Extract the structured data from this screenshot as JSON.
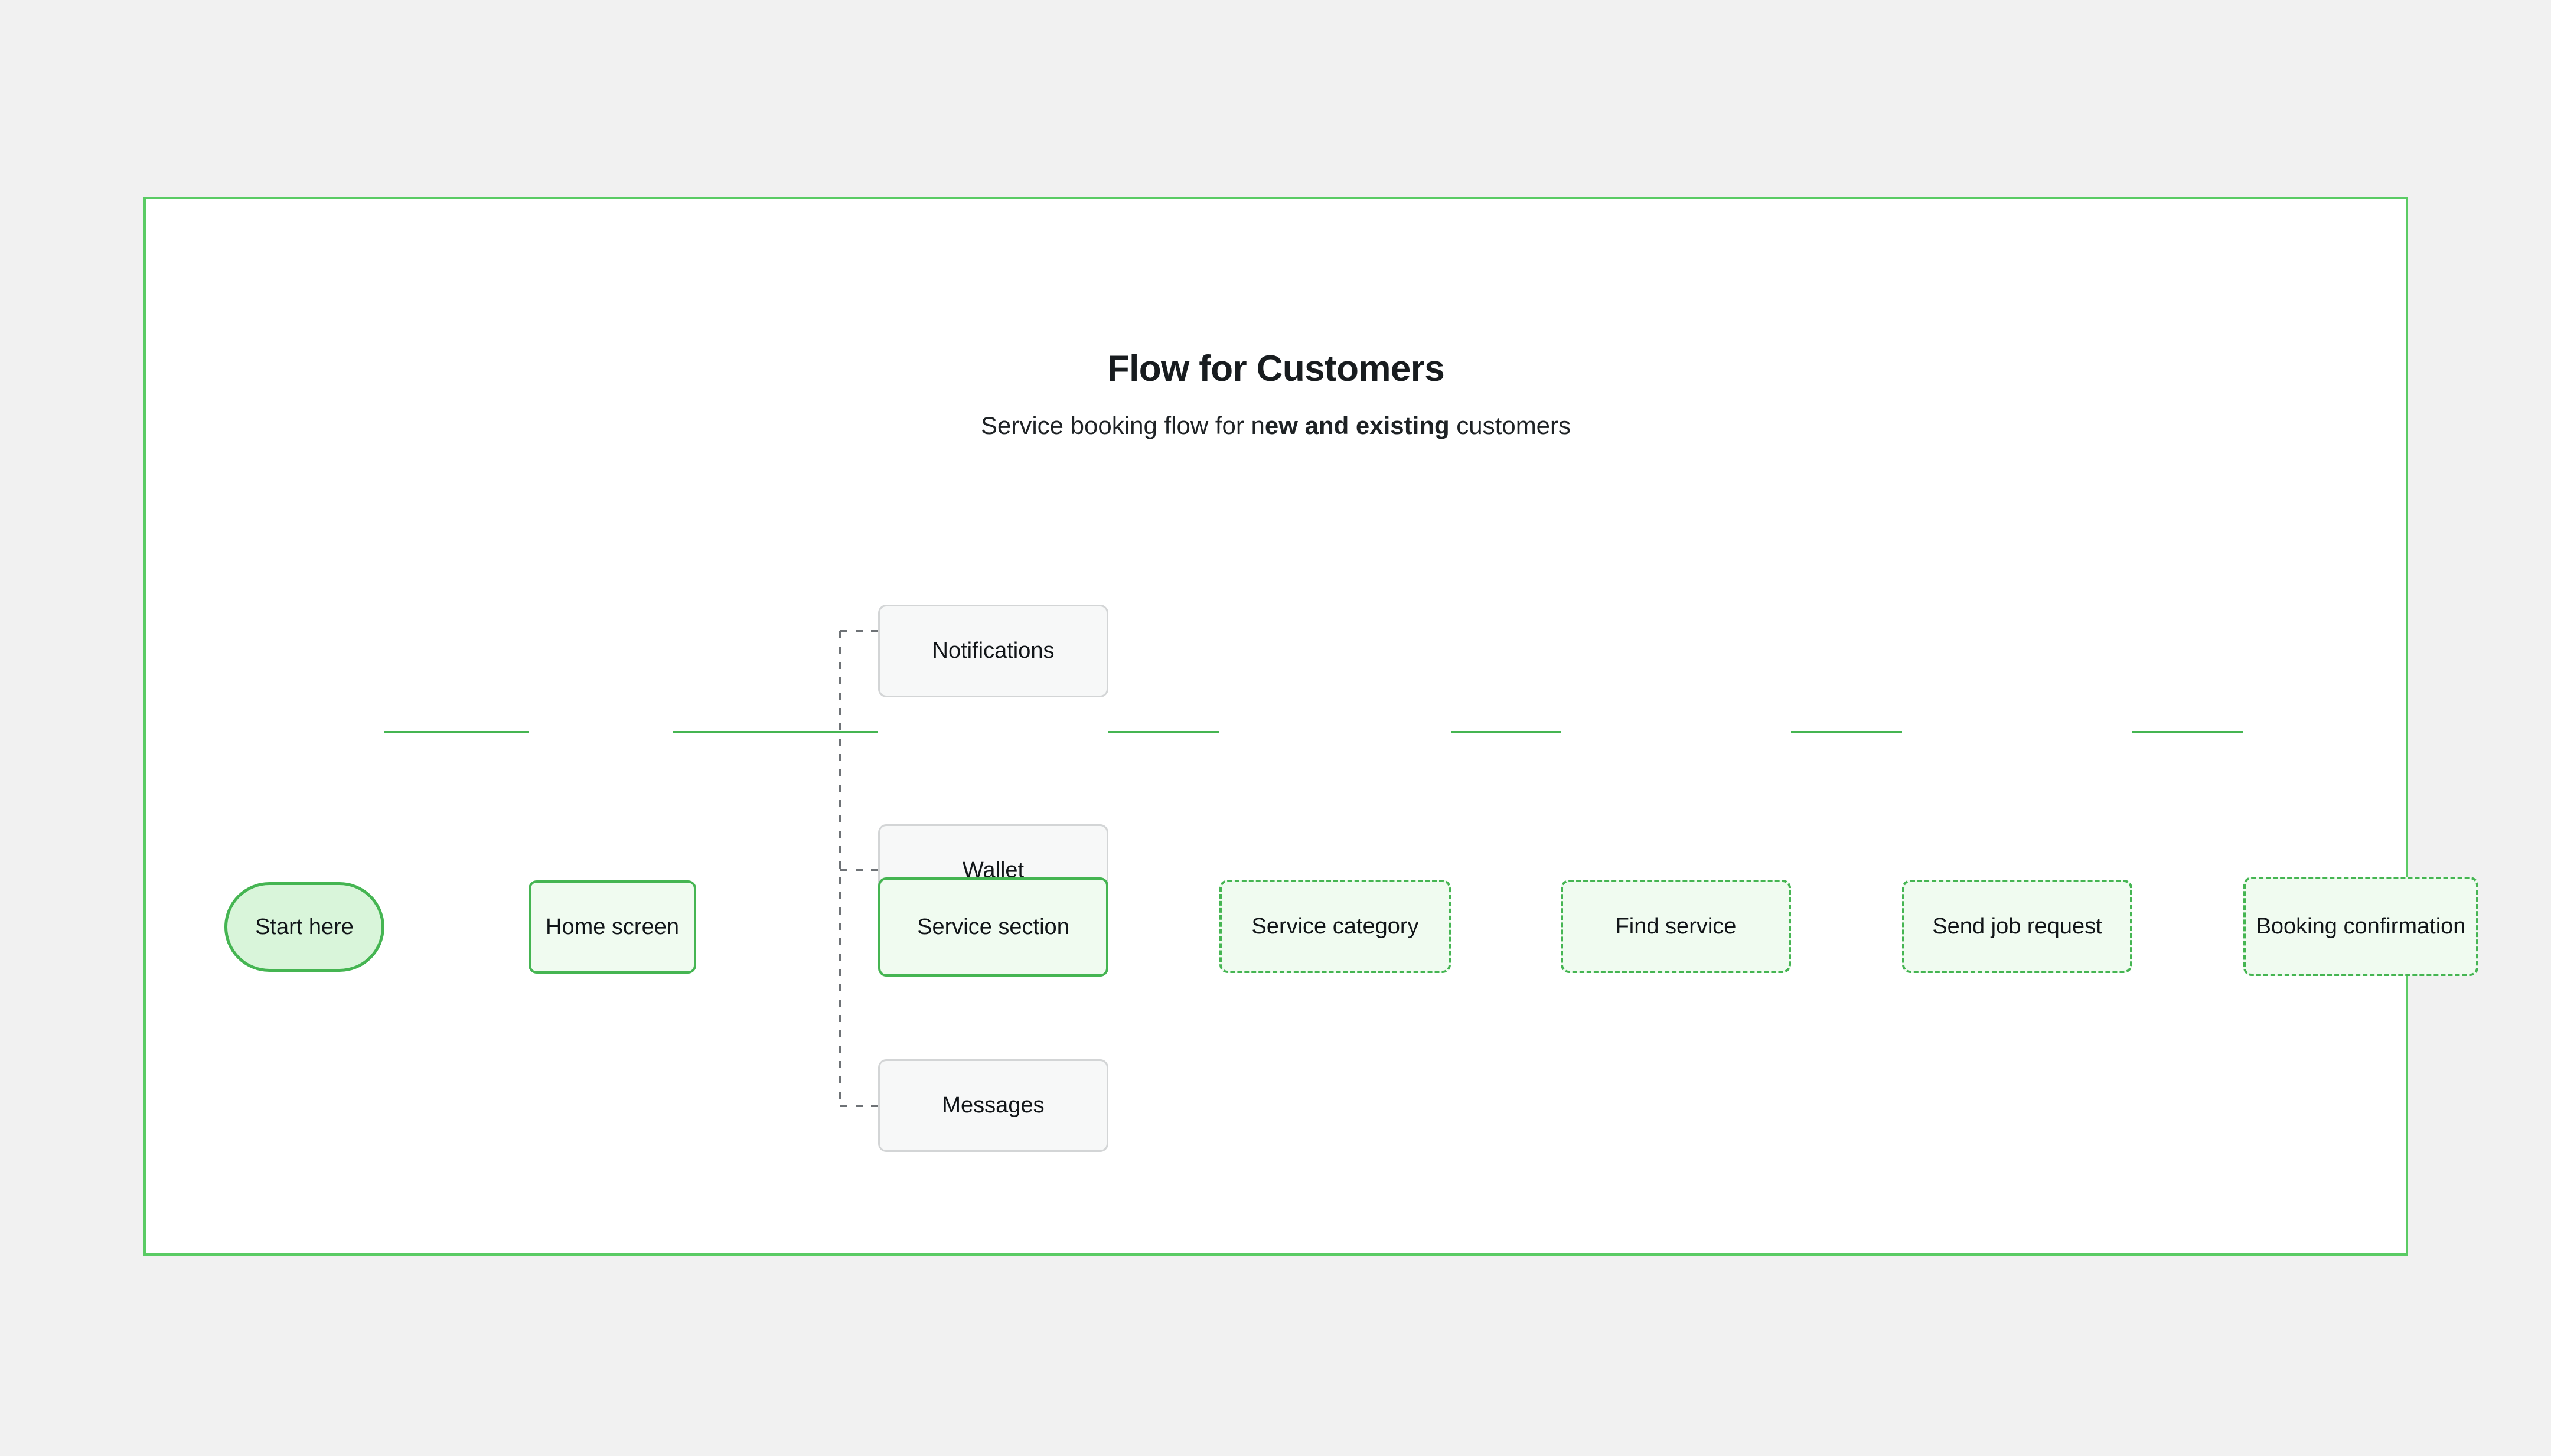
{
  "canvas": {
    "background_color": "#f1f1f1",
    "frame_border_color": "#5ACB64",
    "frame_background": "#ffffff"
  },
  "header": {
    "title": "Flow for Customers",
    "subtitle_prefix": "Service booking flow for n",
    "subtitle_emphasis": "ew and existing",
    "subtitle_suffix": " customers"
  },
  "palette": {
    "green_border": "#45B552",
    "green_fill": "#F0FBF0",
    "pill_fill": "#D9F5DA",
    "gray_border": "#D3D5D6",
    "gray_fill": "#F7F8F8",
    "edge_green": "#45B552",
    "edge_gray": "#6E7276",
    "text": "#111518"
  },
  "nodes": {
    "start": {
      "label": "Start here",
      "shape": "pill",
      "style": "green-solid"
    },
    "home_screen": {
      "label": "Home screen",
      "shape": "rect",
      "style": "green-solid"
    },
    "notifications": {
      "label": "Notifications",
      "shape": "rect",
      "style": "gray"
    },
    "wallet": {
      "label": "Wallet",
      "shape": "rect",
      "style": "gray"
    },
    "service_section": {
      "label": "Service section",
      "shape": "rect",
      "style": "green-solid"
    },
    "messages": {
      "label": "Messages",
      "shape": "rect",
      "style": "gray"
    },
    "service_category": {
      "label": "Service category",
      "shape": "rect",
      "style": "green-dashed"
    },
    "find_service": {
      "label": "Find service",
      "shape": "rect",
      "style": "green-dashed"
    },
    "send_job_request": {
      "label": "Send job request",
      "shape": "rect",
      "style": "green-dashed"
    },
    "booking_confirmation": {
      "label": "Booking confirmation",
      "shape": "rect",
      "style": "green-dashed"
    }
  },
  "flow": {
    "main_sequence": [
      "Start here",
      "Home screen",
      "Service section",
      "Service category",
      "Find service",
      "Send job request",
      "Booking confirmation"
    ],
    "branch_from": "Home screen",
    "branch_targets": [
      "Notifications",
      "Wallet",
      "Messages"
    ],
    "main_connector_style": "solid",
    "branch_connector_style": "dotted"
  }
}
